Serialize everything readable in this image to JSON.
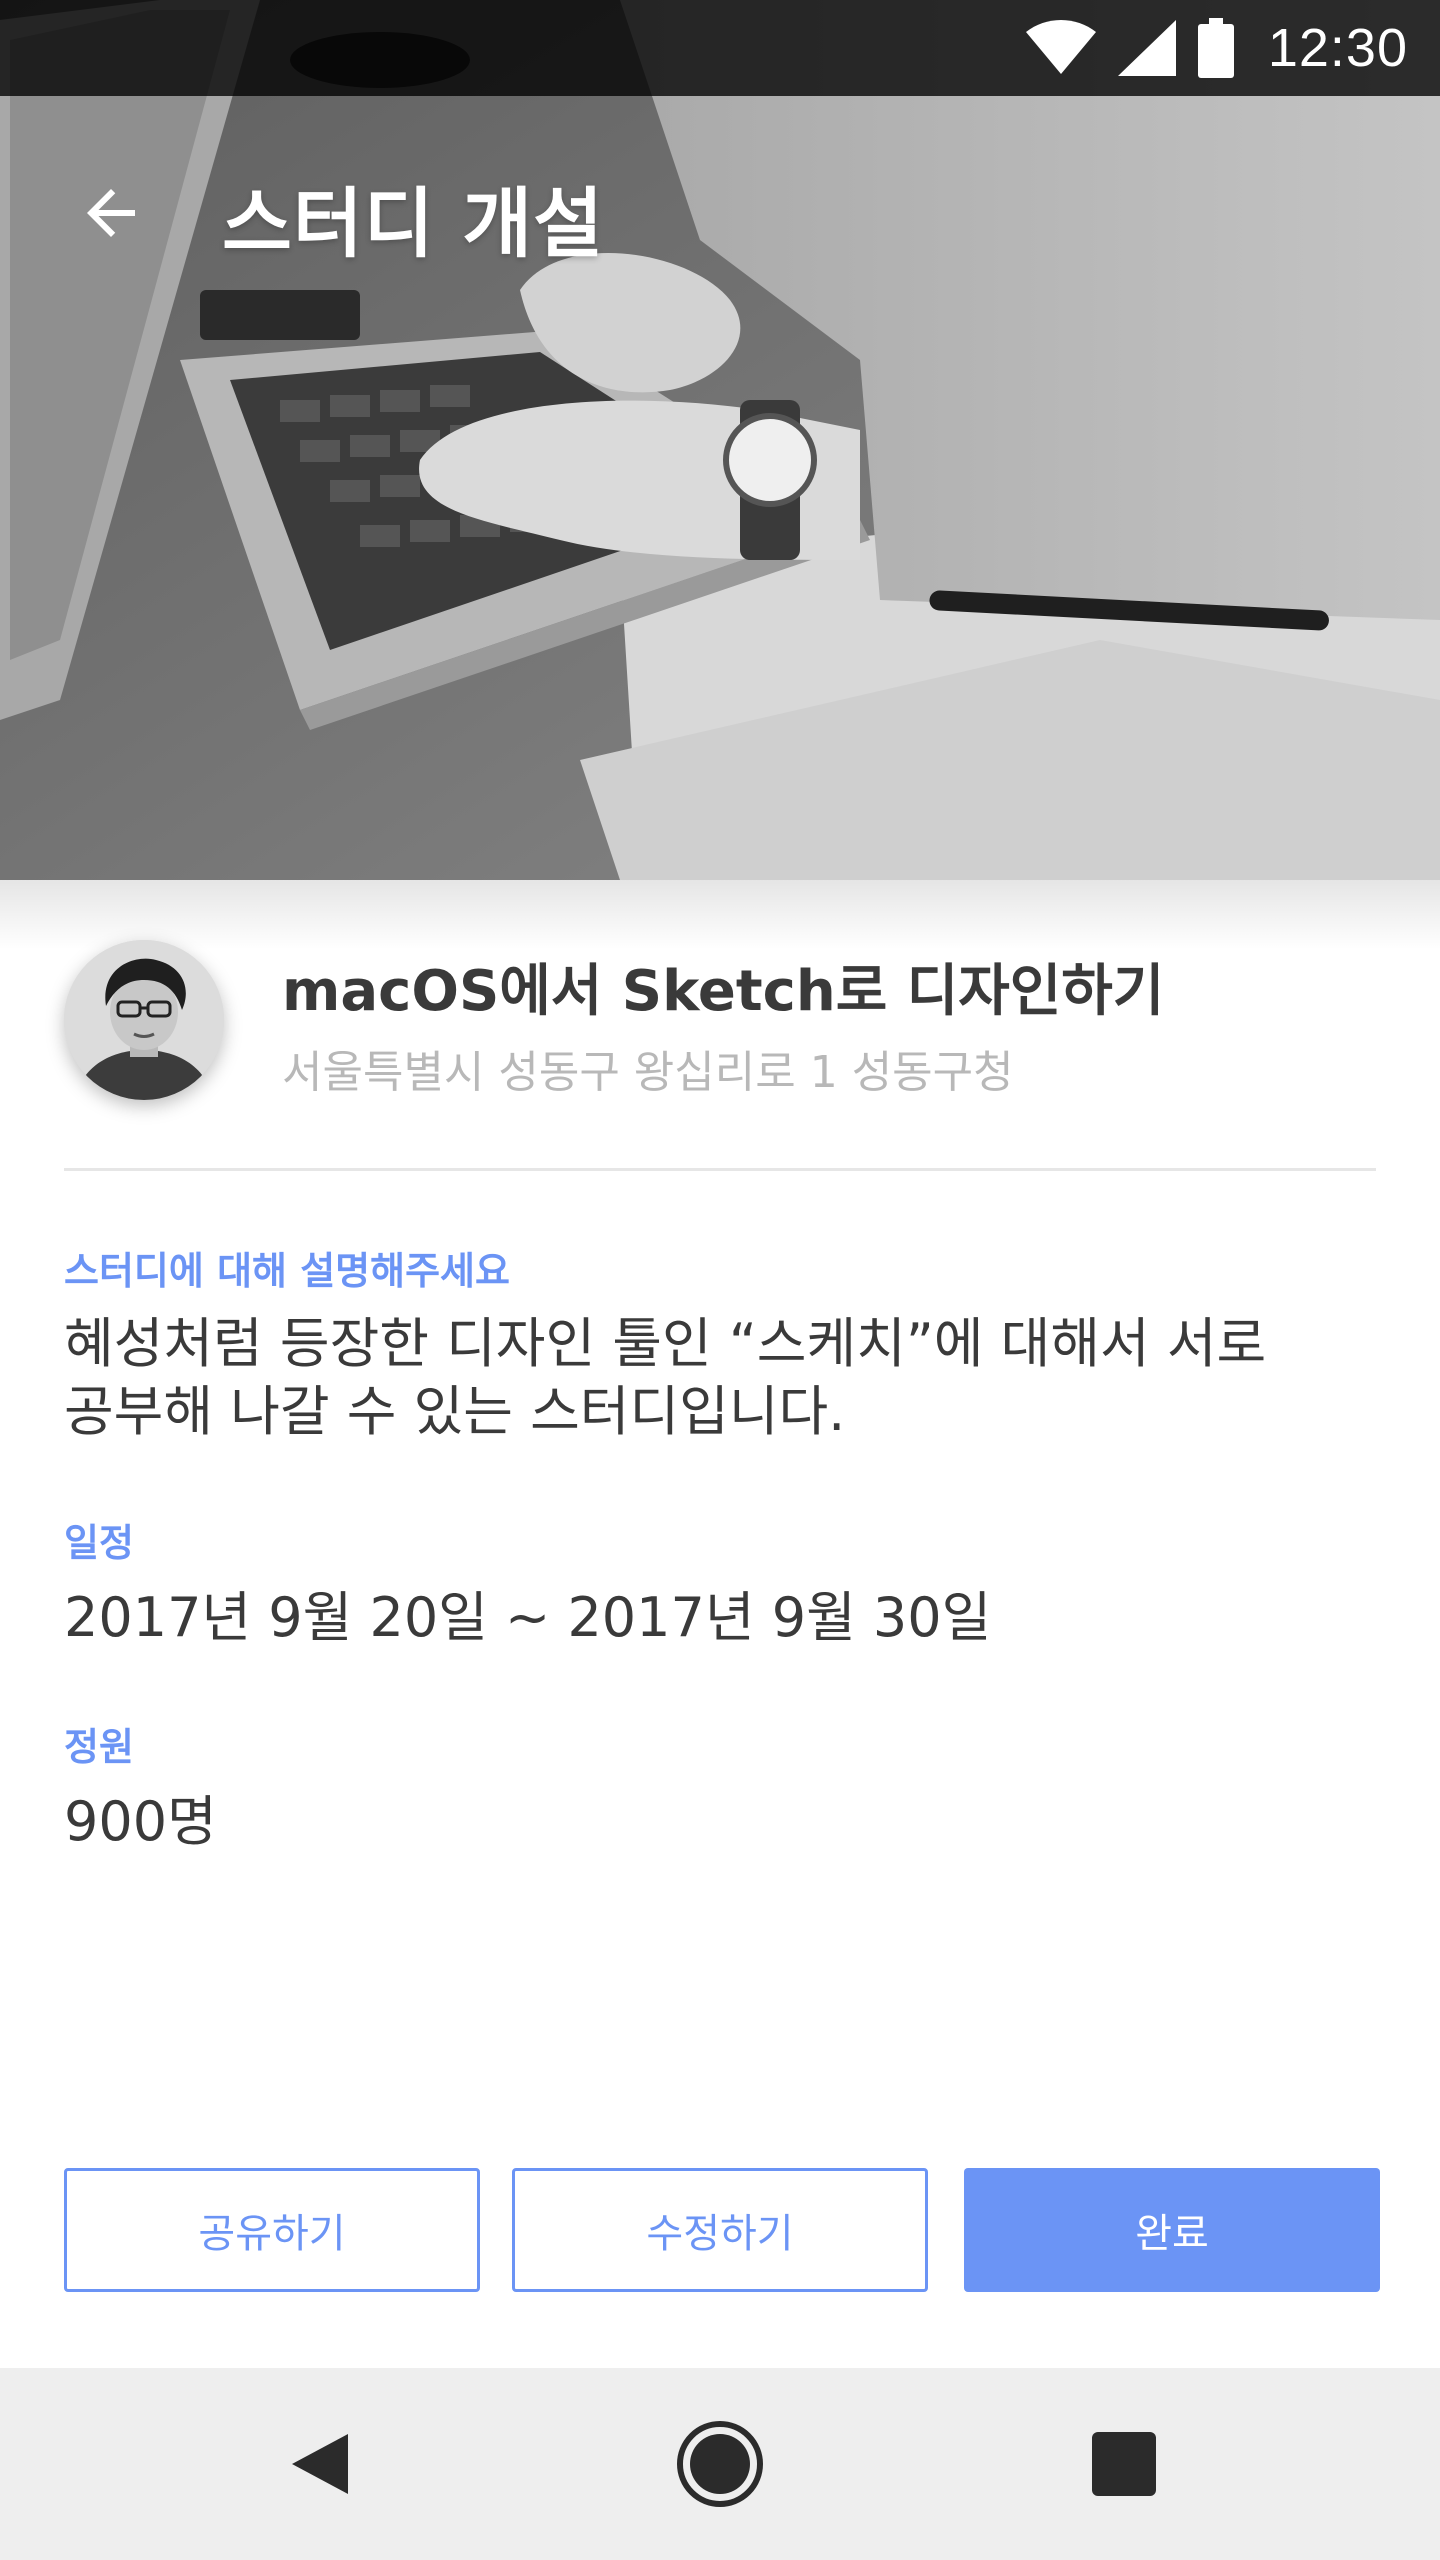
{
  "status_bar": {
    "time": "12:30",
    "icons": [
      "wifi-icon",
      "cellular-signal-icon",
      "battery-icon"
    ]
  },
  "app_bar": {
    "title": "스터디 개설",
    "back_icon": "arrow-back-icon"
  },
  "study": {
    "title": "macOS에서 Sketch로 디자인하기",
    "address": "서울특별시 성동구 왕십리로 1 성동구청"
  },
  "description": {
    "label": "스터디에 대해 설명해주세요",
    "line1": "혜성처럼 등장한 디자인 툴인 “스케치”에 대해서 서로",
    "line2": "공부해 나갈 수 있는 스터디입니다."
  },
  "schedule": {
    "label": "일정",
    "value": "2017년 9월 20일 ~ 2017년 9월 30일"
  },
  "capacity": {
    "label": "정원",
    "value": "900명"
  },
  "actions": {
    "share_label": "공유하기",
    "edit_label": "수정하기",
    "done_label": "완료"
  },
  "nav_bar": {
    "icons": [
      "nav-back-icon",
      "nav-home-icon",
      "nav-recents-icon"
    ]
  },
  "colors": {
    "accent": "#6b94f5",
    "title_text": "#3a3a3a",
    "secondary_text": "#b8b8b8",
    "nav_background": "#eeeeee"
  }
}
